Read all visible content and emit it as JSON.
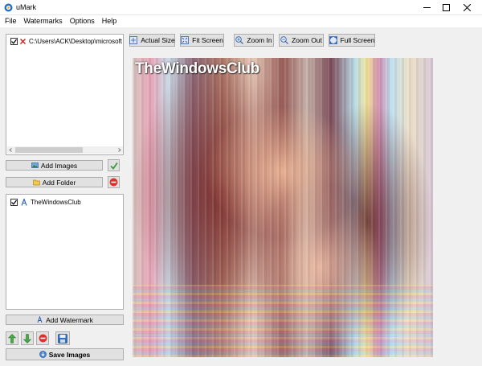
{
  "window": {
    "title": "uMark",
    "app_icon": "umark-logo-icon",
    "controls": [
      "minimize-icon",
      "maximize-icon",
      "close-icon"
    ]
  },
  "menu": {
    "items": [
      "File",
      "Watermarks",
      "Options",
      "Help"
    ]
  },
  "toolbar": {
    "buttons": [
      {
        "label": "Actual Size",
        "icon": "actual-size-icon"
      },
      {
        "label": "Fit Screen",
        "icon": "fit-screen-icon"
      },
      {
        "label": "Zoom In",
        "icon": "zoom-in-icon"
      },
      {
        "label": "Zoom Out",
        "icon": "zoom-out-icon"
      },
      {
        "label": "Full Screen",
        "icon": "full-screen-icon"
      }
    ]
  },
  "images_list": {
    "items": [
      {
        "checked": true,
        "path": "C:\\Users\\ACK\\Desktop\\microsoft r"
      }
    ]
  },
  "image_buttons": {
    "add_images": "Add Images",
    "add_folder": "Add Folder"
  },
  "watermarks_list": {
    "items": [
      {
        "checked": true,
        "type_icon": "text-watermark-icon",
        "name": "TheWindowsClub"
      }
    ]
  },
  "watermark_buttons": {
    "add_watermark": "Add Watermark",
    "save_images": "Save Images"
  },
  "preview": {
    "watermark_text": "TheWindowsClub"
  },
  "colors": {
    "accent_green": "#3a9a3a",
    "remove_red": "#d9322c",
    "button_face": "#e1e1e1",
    "window_bg": "#f0f0f0"
  }
}
